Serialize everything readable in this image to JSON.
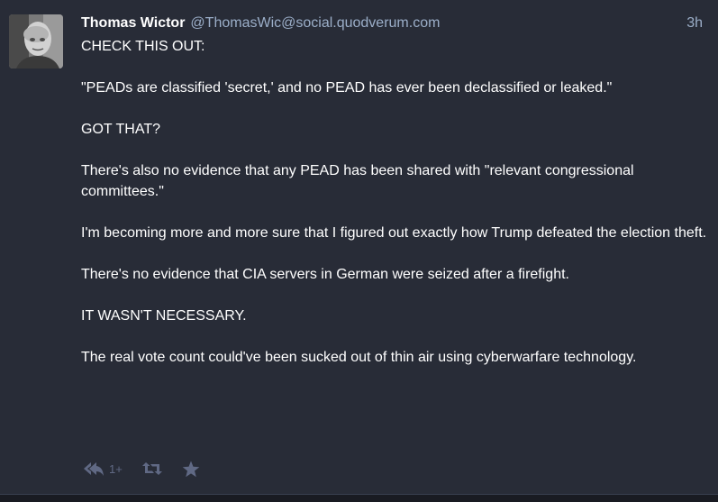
{
  "status": {
    "display_name": "Thomas Wictor",
    "account": "@ThomasWic@social.quodverum.com",
    "time": "3h",
    "paragraphs": [
      "CHECK THIS OUT:",
      "\"PEADs are classified 'secret,' and no PEAD has ever been declassified or leaked.\"",
      "GOT THAT?",
      "There's also no evidence that any PEAD has been shared with \"relevant congressional committees.\"",
      "I'm becoming more and more sure that I figured out exactly how Trump defeated the election theft.",
      "There's no evidence that CIA servers in German were seized after a firefight.",
      "IT WASN'T NECESSARY.",
      "The real vote count could've been sucked out of thin air using cyberwarfare technology."
    ],
    "actions": {
      "reply_icon": "reply-all-icon",
      "reply_count": "1+",
      "boost_icon": "retweet-icon",
      "favourite_icon": "star-icon"
    }
  },
  "colors": {
    "background": "#191b22",
    "card": "#282c37",
    "secondary_text": "#9baec8",
    "action_icon": "#606984"
  }
}
